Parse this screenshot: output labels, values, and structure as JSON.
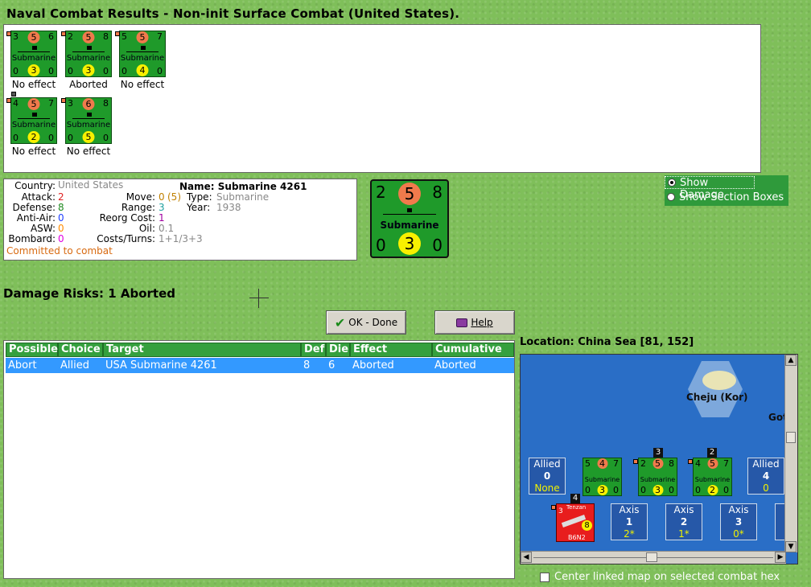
{
  "title": "Naval Combat Results - Non-init Surface Combat (United States).",
  "results": [
    {
      "tl": "3",
      "top": "5",
      "tr": "6",
      "type": "Submarine",
      "bl": "0",
      "bot": "3",
      "br": "0",
      "status": "No effect"
    },
    {
      "tl": "2",
      "top": "5",
      "tr": "8",
      "type": "Submarine",
      "bl": "0",
      "bot": "3",
      "br": "0",
      "status": "Aborted"
    },
    {
      "tl": "5",
      "top": "5",
      "tr": "7",
      "type": "Submarine",
      "bl": "0",
      "bot": "4",
      "br": "0",
      "status": "No effect"
    },
    {
      "tl": "4",
      "top": "5",
      "tr": "7",
      "type": "Submarine",
      "bl": "0",
      "bot": "2",
      "br": "0",
      "status": "No effect"
    },
    {
      "tl": "3",
      "top": "6",
      "tr": "8",
      "type": "Submarine",
      "bl": "0",
      "bot": "5",
      "br": "0",
      "status": "No effect"
    }
  ],
  "unit": {
    "country_label": "Country:",
    "country": "United States",
    "attack_label": "Attack:",
    "attack": "2",
    "defense_label": "Defense:",
    "defense": "8",
    "antiair_label": "Anti-Air:",
    "antiair": "0",
    "asw_label": "ASW:",
    "asw": "0",
    "bombard_label": "Bombard:",
    "bombard": "0",
    "committed": "Committed to combat",
    "name": "Name: Submarine 4261",
    "move_label": "Move:",
    "move": "0",
    "move_extra": "(5)",
    "type_label": "Type:",
    "type": "Submarine",
    "range_label": "Range:",
    "range": "3",
    "year_label": "Year:",
    "year": "1938",
    "reorg_label": "Reorg Cost:",
    "reorg": "1",
    "oil_label": "Oil:",
    "oil": "0.1",
    "costs_label": "Costs/Turns:",
    "costs": "1+1/3+3"
  },
  "big_counter": {
    "tl": "2",
    "top": "5",
    "tr": "8",
    "type": "Submarine",
    "bl": "0",
    "bot": "3",
    "br": "0"
  },
  "options": {
    "show_damage": "Show Damage",
    "show_sections": "Show Section Boxes"
  },
  "damage_risks": "Damage Risks:  1 Aborted",
  "buttons": {
    "ok": "OK - Done",
    "help": "Help"
  },
  "table": {
    "headers": [
      "Possible",
      "Choice",
      "Target",
      "Def",
      "Die",
      "Effect",
      "Cumulative"
    ],
    "rows": [
      [
        "Abort",
        "Allied",
        "USA Submarine 4261",
        "8",
        "6",
        "Aborted",
        "Aborted"
      ]
    ]
  },
  "location": "Location:  China Sea [81, 152]",
  "map": {
    "island": "Cheju (Kor)",
    "edge_label": "Got",
    "allied_left": {
      "label": "Allied",
      "num": "0",
      "sub": "None"
    },
    "allied_right": {
      "label": "Allied",
      "num": "4",
      "sub": "0"
    },
    "map_units": [
      {
        "tl": "5",
        "top": "4",
        "tr": "7",
        "type": "Submarine",
        "bl": "0",
        "bot": "3",
        "br": "0",
        "stack": ""
      },
      {
        "tl": "2",
        "top": "5",
        "tr": "8",
        "type": "Submarine",
        "bl": "0",
        "bot": "3",
        "br": "0",
        "stack": "3"
      },
      {
        "tl": "4",
        "top": "5",
        "tr": "7",
        "type": "Submarine",
        "bl": "0",
        "bot": "2",
        "br": "0",
        "stack": "2"
      }
    ],
    "axis_unit": {
      "name": "Tenzan",
      "code": "B6N2",
      "att": "3",
      "def": "8",
      "stack": "4"
    },
    "axis_cards": [
      {
        "label": "Axis",
        "num": "1",
        "sub": "2*"
      },
      {
        "label": "Axis",
        "num": "2",
        "sub": "1*"
      },
      {
        "label": "Axis",
        "num": "3",
        "sub": "0*"
      }
    ]
  },
  "center_linked": "Center linked map on selected combat hex",
  "colors": {
    "attack": "#e02020",
    "defense": "#208a20",
    "antiair": "#2040ff",
    "asw": "#ff8c00",
    "bombard": "#e000e0",
    "committed": "#d86a10",
    "accent_green": "#35a03e",
    "selection": "#3399ff"
  }
}
